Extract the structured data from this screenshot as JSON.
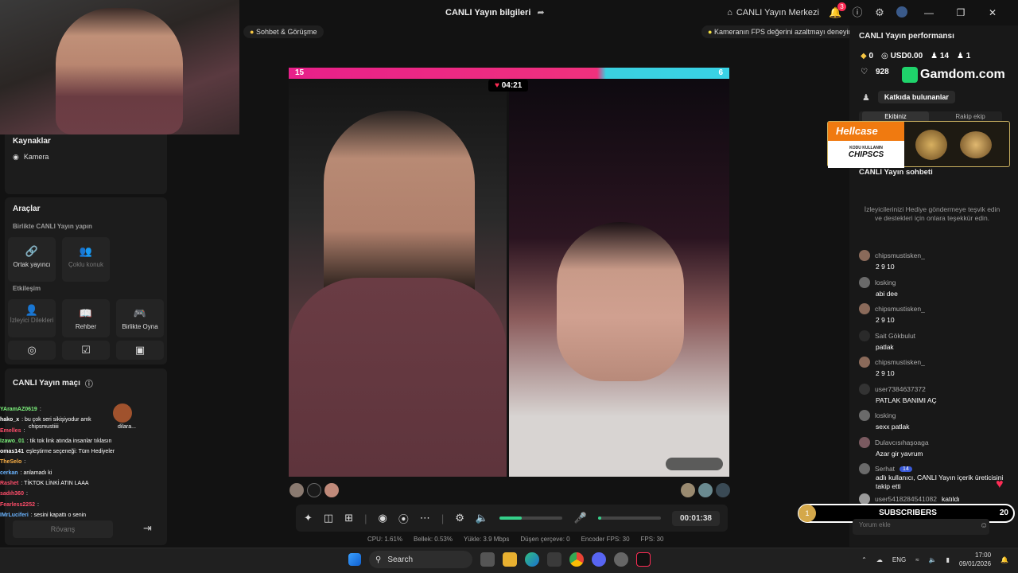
{
  "titlebar": {
    "title": "CANLI Yayın bilgileri",
    "live_center": "CANLI Yayın Merkezi",
    "notif_count": "3"
  },
  "left": {
    "sources_title": "Kaynaklar",
    "camera_label": "Kamera",
    "tools_title": "Araçlar",
    "collab_sub": "Birlikte CANLI Yayın yapın",
    "cohost_label": "Ortak yayıncı",
    "multiguest_label": "Çoklu konuk",
    "interaction_sub": "Etkileşim",
    "viewer_wishes_label": "İzleyici Dilekleri",
    "guide_label": "Rehber",
    "play_together_label": "Birlikte Oyna",
    "match_title": "CANLI Yayın maçı",
    "rematch_label": "Rövanş",
    "match_name_left": "chipsmustiiii",
    "match_name_right": "dilara..."
  },
  "overlay_chat": [
    {
      "user": "YAramAZ0619",
      "msg": ":",
      "color": "#7cf27c"
    },
    {
      "user": "hako_x",
      "msg": ": bu çok seri sikişiyodur amk",
      "color": "#ffffff"
    },
    {
      "user": "Emelles",
      "msg": ":",
      "color": "#ff4d6a"
    },
    {
      "user": "Izawo_01",
      "msg": ": tik tok link atında insanlar tıklasın",
      "color": "#7cf27c"
    },
    {
      "user": "omas141",
      "msg": "eşleştirme seçeneği: Tüm Hediyeler",
      "color": "#ffffff"
    },
    {
      "user": "TheSelo",
      "msg": ":",
      "color": "#ffb347"
    },
    {
      "user": "cerkan",
      "msg": ": anlamadı ki",
      "color": "#6ab4ff"
    },
    {
      "user": "Rashet",
      "msg": ": TİKTOK LİNKİ ATIN LAAA",
      "color": "#ff4d6a"
    },
    {
      "user": "sadıh360",
      "msg": ":",
      "color": "#ff4d6a"
    },
    {
      "user": "Fearless2252",
      "msg": ":",
      "color": "#ff4d6a"
    },
    {
      "user": "IMrLuciferi",
      "msg": ": sesini kapattı o senin",
      "color": "#6ab4ff"
    }
  ],
  "center": {
    "pill_left": "Sohbet & Görüşme",
    "pill_right": "Kameranın FPS değerini azaltmayı deneyin",
    "score_left": "15",
    "score_right": "6",
    "battle_timer": "04:21",
    "elapsed": "00:01:38",
    "volume_level": 0.35,
    "mic_level": 0.05
  },
  "stats": {
    "cpu": "CPU: 1.61%",
    "memory": "Bellek: 0.53%",
    "upload": "Yükle: 3.9 Mbps",
    "dropped": "Düşen çerçeve: 0",
    "encoder_fps": "Encoder FPS: 30",
    "fps": "FPS: 30"
  },
  "right": {
    "perf_title": "CANLI Yayın performansı",
    "diamonds": "0",
    "usd": "USD0.00",
    "viewers": "14",
    "followers": "1",
    "likes": "928",
    "sponsor_gamdom": "Gamdom.com",
    "contributors_label": "Katkıda bulunanlar",
    "tab_team": "Ekibiniz",
    "tab_rival": "Rakip ekip",
    "hellcase_name": "Hellcase",
    "hellcase_promo": "KODU KULLANIN",
    "hellcase_code": "CHIPSCS",
    "chat_title": "CANLI Yayın sohbeti",
    "gift_hint": "İzleyicilerinizi Hediye göndermeye teşvik edin ve destekleri için onlara teşekkür edin.",
    "chat": [
      {
        "user": "chipsmustisken_",
        "msg": "2 9 10",
        "avatar": "#8a6a5a"
      },
      {
        "user": "losking",
        "msg": "abi dee",
        "avatar": "#6a6a6a"
      },
      {
        "user": "chipsmustisken_",
        "msg": "2 9 10",
        "avatar": "#8a6a5a"
      },
      {
        "user": "Sait Gökbulut",
        "msg": "patlak",
        "avatar": "#2a2a2a"
      },
      {
        "user": "chipsmustisken_",
        "msg": "2 9 10",
        "avatar": "#8a6a5a"
      },
      {
        "user": "user7384637372",
        "msg": "PATLAK BANIMI AÇ",
        "avatar": "#333333"
      },
      {
        "user": "losking",
        "msg": "sexx patlak",
        "avatar": "#6a6a6a"
      },
      {
        "user": "Dulavcısıhaşoaga",
        "msg": "Azar gir yavrum",
        "avatar": "#7a5a60"
      },
      {
        "user": "Serhat",
        "msg": "adlı kullanıcı, CANLI Yayın içerik üreticisini takip etti",
        "avatar": "#6a6a6a",
        "level": "14"
      },
      {
        "user": "user5418284541082",
        "msg": "katıldı",
        "avatar": "#9a9a9a"
      }
    ],
    "subscribers_label": "SUBSCRIBERS",
    "sub_current": "1",
    "sub_goal": "20",
    "comment_placeholder": "Yorum ekle"
  },
  "taskbar": {
    "search": "Search",
    "lang": "ENG",
    "time": "17:00",
    "date": "09/01/2026"
  },
  "colors": {
    "accent_pink": "#fe2c55",
    "score_pink": "#e8208a",
    "score_cyan": "#3ad0e0",
    "volume_green": "#35d08a"
  }
}
